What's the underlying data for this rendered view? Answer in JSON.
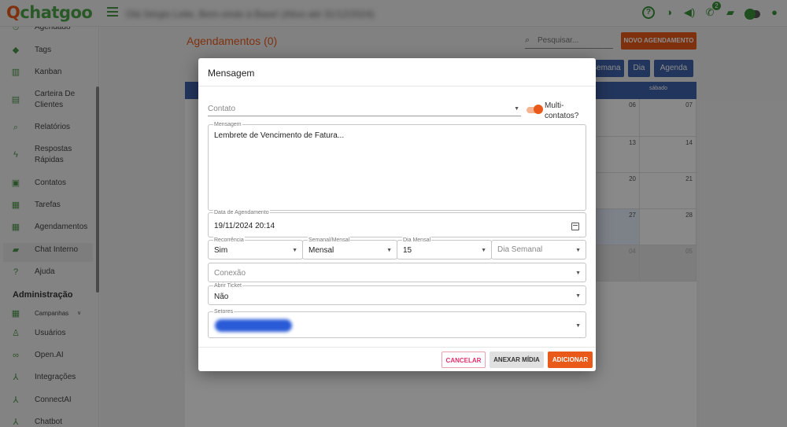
{
  "app": {
    "logo_text": "chatgoo",
    "greeting": "Olá Sérgio Leite, Bem-vindo à Base! (Ativo até 31/12/2024)"
  },
  "topbar": {
    "notification_count": "2"
  },
  "sidebar": {
    "items": [
      {
        "label": "Agendado",
        "icon": "clock-icon"
      },
      {
        "label": "Tags",
        "icon": "tag-icon"
      },
      {
        "label": "Kanban",
        "icon": "kanban-icon"
      },
      {
        "label": "Carteira De Clientes",
        "icon": "wallet-icon"
      },
      {
        "label": "Relatórios",
        "icon": "search-icon"
      },
      {
        "label": "Respostas Rápidas",
        "icon": "bolt-icon"
      },
      {
        "label": "Contatos",
        "icon": "contacts-icon"
      },
      {
        "label": "Tarefas",
        "icon": "tasks-icon"
      },
      {
        "label": "Agendamentos",
        "icon": "calendar-icon"
      },
      {
        "label": "Chat Interno",
        "icon": "chat-icon"
      },
      {
        "label": "Ajuda",
        "icon": "help-icon"
      }
    ],
    "section_admin": "Administração",
    "admin_items": [
      {
        "label": "Campanhas",
        "icon": "campaign-icon"
      },
      {
        "label": "Usuários",
        "icon": "users-icon"
      },
      {
        "label": "Open.AI",
        "icon": "infinity-icon"
      },
      {
        "label": "Integrações",
        "icon": "integration-icon"
      },
      {
        "label": "ConnectAI",
        "icon": "connect-icon"
      },
      {
        "label": "Chatbot",
        "icon": "chatbot-icon"
      }
    ]
  },
  "page": {
    "title": "Agendamentos (0)",
    "search_placeholder": "Pesquisar...",
    "new_button": "NOVO AGENDAMENTO",
    "view_buttons": [
      "Semana",
      "Dia",
      "Agenda"
    ],
    "calendar_column_header": "sábado",
    "calendar_days_col1": [
      "06",
      "13",
      "20",
      "27",
      "04"
    ],
    "calendar_days_col2": [
      "07",
      "14",
      "21",
      "28",
      "05"
    ]
  },
  "modal": {
    "title": "Mensagem",
    "contato_label": "Contato",
    "multi_contacts_label": "Multi-contatos?",
    "message_legend": "Mensagem",
    "message_value": "Lembrete de Vencimento de Fatura...",
    "schedule_legend": "Data de Agendamento",
    "schedule_value": "19/11/2024 20:14",
    "recurrence_legend": "Recorrência",
    "recurrence_value": "Sim",
    "weekly_monthly_legend": "Semanal/Mensal",
    "weekly_monthly_value": "Mensal",
    "month_day_legend": "Dia Mensal",
    "month_day_value": "15",
    "week_day_placeholder": "Dia Semanal",
    "connection_placeholder": "Conexão",
    "open_ticket_legend": "Abrir Ticket",
    "open_ticket_value": "Não",
    "sectors_legend": "Setores",
    "cancel_button": "CANCELAR",
    "attach_button": "ANEXAR MÍDIA",
    "add_button": "ADICIONAR"
  }
}
